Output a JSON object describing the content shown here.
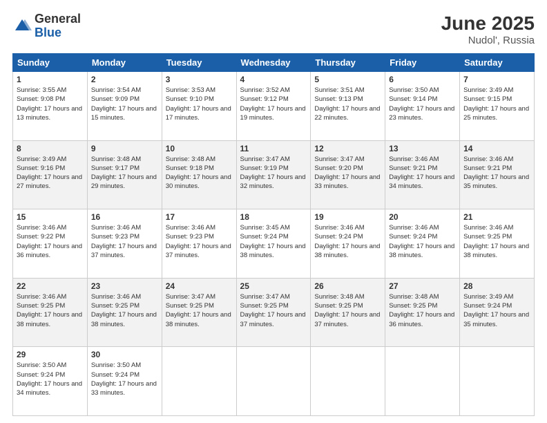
{
  "logo": {
    "general": "General",
    "blue": "Blue"
  },
  "header": {
    "month": "June 2025",
    "location": "Nudol', Russia"
  },
  "weekdays": [
    "Sunday",
    "Monday",
    "Tuesday",
    "Wednesday",
    "Thursday",
    "Friday",
    "Saturday"
  ],
  "weeks": [
    [
      {
        "day": "1",
        "sunrise": "3:55 AM",
        "sunset": "9:08 PM",
        "daylight": "17 hours and 13 minutes."
      },
      {
        "day": "2",
        "sunrise": "3:54 AM",
        "sunset": "9:09 PM",
        "daylight": "17 hours and 15 minutes."
      },
      {
        "day": "3",
        "sunrise": "3:53 AM",
        "sunset": "9:10 PM",
        "daylight": "17 hours and 17 minutes."
      },
      {
        "day": "4",
        "sunrise": "3:52 AM",
        "sunset": "9:12 PM",
        "daylight": "17 hours and 19 minutes."
      },
      {
        "day": "5",
        "sunrise": "3:51 AM",
        "sunset": "9:13 PM",
        "daylight": "17 hours and 22 minutes."
      },
      {
        "day": "6",
        "sunrise": "3:50 AM",
        "sunset": "9:14 PM",
        "daylight": "17 hours and 23 minutes."
      },
      {
        "day": "7",
        "sunrise": "3:49 AM",
        "sunset": "9:15 PM",
        "daylight": "17 hours and 25 minutes."
      }
    ],
    [
      {
        "day": "8",
        "sunrise": "3:49 AM",
        "sunset": "9:16 PM",
        "daylight": "17 hours and 27 minutes."
      },
      {
        "day": "9",
        "sunrise": "3:48 AM",
        "sunset": "9:17 PM",
        "daylight": "17 hours and 29 minutes."
      },
      {
        "day": "10",
        "sunrise": "3:48 AM",
        "sunset": "9:18 PM",
        "daylight": "17 hours and 30 minutes."
      },
      {
        "day": "11",
        "sunrise": "3:47 AM",
        "sunset": "9:19 PM",
        "daylight": "17 hours and 32 minutes."
      },
      {
        "day": "12",
        "sunrise": "3:47 AM",
        "sunset": "9:20 PM",
        "daylight": "17 hours and 33 minutes."
      },
      {
        "day": "13",
        "sunrise": "3:46 AM",
        "sunset": "9:21 PM",
        "daylight": "17 hours and 34 minutes."
      },
      {
        "day": "14",
        "sunrise": "3:46 AM",
        "sunset": "9:21 PM",
        "daylight": "17 hours and 35 minutes."
      }
    ],
    [
      {
        "day": "15",
        "sunrise": "3:46 AM",
        "sunset": "9:22 PM",
        "daylight": "17 hours and 36 minutes."
      },
      {
        "day": "16",
        "sunrise": "3:46 AM",
        "sunset": "9:23 PM",
        "daylight": "17 hours and 37 minutes."
      },
      {
        "day": "17",
        "sunrise": "3:46 AM",
        "sunset": "9:23 PM",
        "daylight": "17 hours and 37 minutes."
      },
      {
        "day": "18",
        "sunrise": "3:45 AM",
        "sunset": "9:24 PM",
        "daylight": "17 hours and 38 minutes."
      },
      {
        "day": "19",
        "sunrise": "3:46 AM",
        "sunset": "9:24 PM",
        "daylight": "17 hours and 38 minutes."
      },
      {
        "day": "20",
        "sunrise": "3:46 AM",
        "sunset": "9:24 PM",
        "daylight": "17 hours and 38 minutes."
      },
      {
        "day": "21",
        "sunrise": "3:46 AM",
        "sunset": "9:25 PM",
        "daylight": "17 hours and 38 minutes."
      }
    ],
    [
      {
        "day": "22",
        "sunrise": "3:46 AM",
        "sunset": "9:25 PM",
        "daylight": "17 hours and 38 minutes."
      },
      {
        "day": "23",
        "sunrise": "3:46 AM",
        "sunset": "9:25 PM",
        "daylight": "17 hours and 38 minutes."
      },
      {
        "day": "24",
        "sunrise": "3:47 AM",
        "sunset": "9:25 PM",
        "daylight": "17 hours and 38 minutes."
      },
      {
        "day": "25",
        "sunrise": "3:47 AM",
        "sunset": "9:25 PM",
        "daylight": "17 hours and 37 minutes."
      },
      {
        "day": "26",
        "sunrise": "3:48 AM",
        "sunset": "9:25 PM",
        "daylight": "17 hours and 37 minutes."
      },
      {
        "day": "27",
        "sunrise": "3:48 AM",
        "sunset": "9:25 PM",
        "daylight": "17 hours and 36 minutes."
      },
      {
        "day": "28",
        "sunrise": "3:49 AM",
        "sunset": "9:24 PM",
        "daylight": "17 hours and 35 minutes."
      }
    ],
    [
      {
        "day": "29",
        "sunrise": "3:50 AM",
        "sunset": "9:24 PM",
        "daylight": "17 hours and 34 minutes."
      },
      {
        "day": "30",
        "sunrise": "3:50 AM",
        "sunset": "9:24 PM",
        "daylight": "17 hours and 33 minutes."
      },
      null,
      null,
      null,
      null,
      null
    ]
  ]
}
